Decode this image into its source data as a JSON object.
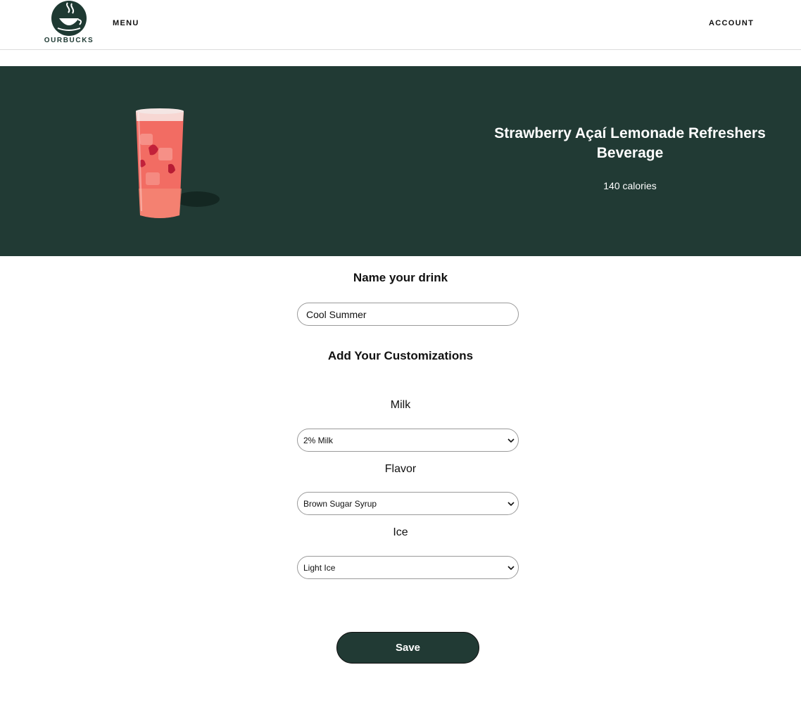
{
  "header": {
    "logo_text": "OURBUCKS",
    "menu_label": "MENU",
    "account_label": "ACCOUNT"
  },
  "hero": {
    "title": "Strawberry Açaí Lemonade Refreshers Beverage",
    "calories": "140 calories",
    "image_icon": "drink-image"
  },
  "form": {
    "name_title": "Name your drink",
    "name_value": "Cool Summer",
    "customizations_title": "Add Your Customizations",
    "milk": {
      "label": "Milk",
      "selected": "2% Milk"
    },
    "flavor": {
      "label": "Flavor",
      "selected": "Brown Sugar Syrup"
    },
    "ice": {
      "label": "Ice",
      "selected": "Light Ice"
    },
    "save_label": "Save"
  },
  "colors": {
    "brand_dark_green": "#213a34",
    "logo_green": "#1e3932",
    "border_gray": "#9a9a9a"
  }
}
